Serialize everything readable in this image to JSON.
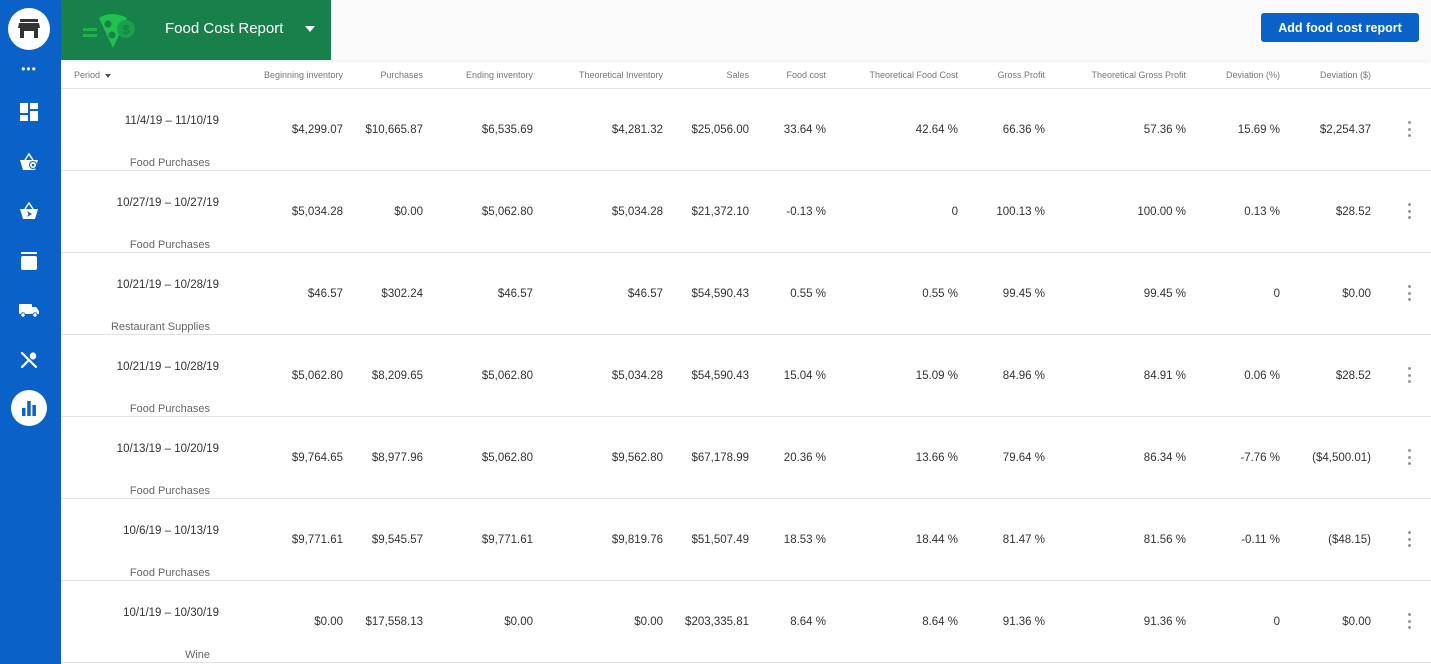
{
  "header": {
    "report_title": "Food Cost Report",
    "add_button_label": "Add food cost report",
    "brand_green": "#18804a",
    "accent_blue": "#0a62c9"
  },
  "sidebar": {
    "more_label": "•••",
    "items": [
      {
        "icon": "dashboard-icon"
      },
      {
        "icon": "basket-add-icon"
      },
      {
        "icon": "basket-send-icon"
      },
      {
        "icon": "archive-box-icon"
      },
      {
        "icon": "truck-icon"
      },
      {
        "icon": "fork-knife-icon"
      },
      {
        "icon": "bar-chart-icon",
        "active": true
      }
    ]
  },
  "table": {
    "columns": [
      "Period",
      "Beginning inventory",
      "Purchases",
      "Ending inventory",
      "Theoretical Inventory",
      "Sales",
      "Food cost",
      "Theoretical Food Cost",
      "Gross Profit",
      "Theoretical Gross Profit",
      "Deviation (%)",
      "Deviation ($)"
    ],
    "rows": [
      {
        "period": "11/4/19 – 11/10/19",
        "category": "Food Purchases",
        "beginning_inventory": "$4,299.07",
        "purchases": "$10,665.87",
        "ending_inventory": "$6,535.69",
        "theoretical_inventory": "$4,281.32",
        "sales": "$25,056.00",
        "food_cost": "33.64 %",
        "theoretical_food_cost": "42.64 %",
        "gross_profit": "66.36 %",
        "theoretical_gross_profit": "57.36 %",
        "deviation_pct": "15.69 %",
        "deviation_usd": "$2,254.37"
      },
      {
        "period": "10/27/19 – 10/27/19",
        "category": "Food Purchases",
        "beginning_inventory": "$5,034.28",
        "purchases": "$0.00",
        "ending_inventory": "$5,062.80",
        "theoretical_inventory": "$5,034.28",
        "sales": "$21,372.10",
        "food_cost": "-0.13 %",
        "theoretical_food_cost": "0",
        "gross_profit": "100.13 %",
        "theoretical_gross_profit": "100.00 %",
        "deviation_pct": "0.13 %",
        "deviation_usd": "$28.52"
      },
      {
        "period": "10/21/19 – 10/28/19",
        "category": "Restaurant Supplies",
        "beginning_inventory": "$46.57",
        "purchases": "$302.24",
        "ending_inventory": "$46.57",
        "theoretical_inventory": "$46.57",
        "sales": "$54,590.43",
        "food_cost": "0.55 %",
        "theoretical_food_cost": "0.55 %",
        "gross_profit": "99.45 %",
        "theoretical_gross_profit": "99.45 %",
        "deviation_pct": "0",
        "deviation_usd": "$0.00"
      },
      {
        "period": "10/21/19 – 10/28/19",
        "category": "Food Purchases",
        "beginning_inventory": "$5,062.80",
        "purchases": "$8,209.65",
        "ending_inventory": "$5,062.80",
        "theoretical_inventory": "$5,034.28",
        "sales": "$54,590.43",
        "food_cost": "15.04 %",
        "theoretical_food_cost": "15.09 %",
        "gross_profit": "84.96 %",
        "theoretical_gross_profit": "84.91 %",
        "deviation_pct": "0.06 %",
        "deviation_usd": "$28.52"
      },
      {
        "period": "10/13/19 – 10/20/19",
        "category": "Food Purchases",
        "beginning_inventory": "$9,764.65",
        "purchases": "$8,977.96",
        "ending_inventory": "$5,062.80",
        "theoretical_inventory": "$9,562.80",
        "sales": "$67,178.99",
        "food_cost": "20.36 %",
        "theoretical_food_cost": "13.66 %",
        "gross_profit": "79.64 %",
        "theoretical_gross_profit": "86.34 %",
        "deviation_pct": "-7.76 %",
        "deviation_usd": "($4,500.01)"
      },
      {
        "period": "10/6/19 – 10/13/19",
        "category": "Food Purchases",
        "beginning_inventory": "$9,771.61",
        "purchases": "$9,545.57",
        "ending_inventory": "$9,771.61",
        "theoretical_inventory": "$9,819.76",
        "sales": "$51,507.49",
        "food_cost": "18.53 %",
        "theoretical_food_cost": "18.44 %",
        "gross_profit": "81.47 %",
        "theoretical_gross_profit": "81.56 %",
        "deviation_pct": "-0.11 %",
        "deviation_usd": "($48.15)"
      },
      {
        "period": "10/1/19 – 10/30/19",
        "category": "Wine",
        "beginning_inventory": "$0.00",
        "purchases": "$17,558.13",
        "ending_inventory": "$0.00",
        "theoretical_inventory": "$0.00",
        "sales": "$203,335.81",
        "food_cost": "8.64 %",
        "theoretical_food_cost": "8.64 %",
        "gross_profit": "91.36 %",
        "theoretical_gross_profit": "91.36 %",
        "deviation_pct": "0",
        "deviation_usd": "$0.00"
      }
    ]
  }
}
